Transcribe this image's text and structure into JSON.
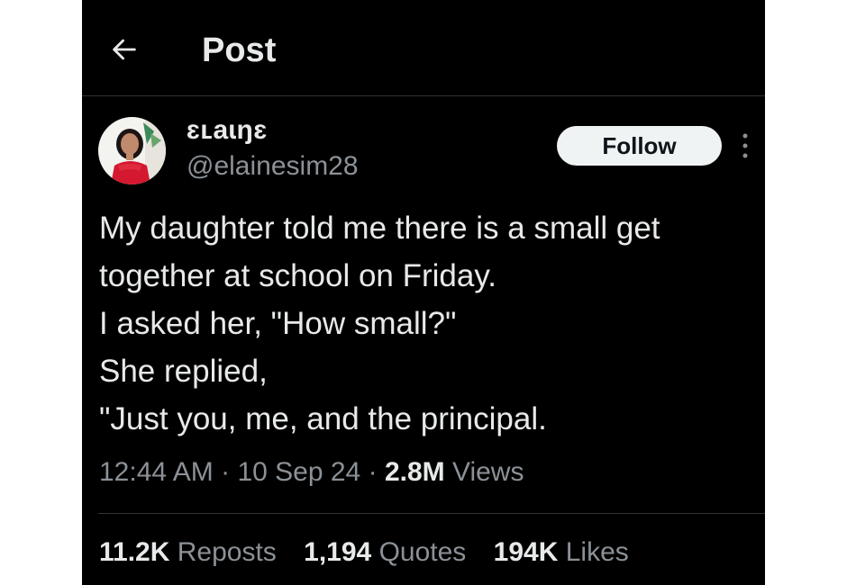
{
  "header": {
    "back_icon": "arrow-left-icon",
    "title": "Post"
  },
  "author": {
    "display_name": "ɛʟaɩŋɛ",
    "handle": "@elainesim28",
    "follow_label": "Follow",
    "more_icon": "more-vertical-icon"
  },
  "tweet": {
    "lines": [
      "My daughter told me there is a small get",
      "together at school on Friday.",
      "I asked her, \"How small?\"",
      "She replied,",
      "\"Just you, me, and the principal."
    ]
  },
  "meta": {
    "time": "12:44 AM",
    "separator": "·",
    "date": "10 Sep 24",
    "views_count": "2.8M",
    "views_label": "Views"
  },
  "stats": {
    "reposts_count": "11.2K",
    "reposts_label": "Reposts",
    "quotes_count": "1,194",
    "quotes_label": "Quotes",
    "likes_count": "194K",
    "likes_label": "Likes"
  },
  "colors": {
    "background": "#000000",
    "primary_text": "#e7e9ea",
    "secondary_text": "#8b9197",
    "divider": "#2f3336",
    "follow_button_bg": "#eff3f4"
  }
}
